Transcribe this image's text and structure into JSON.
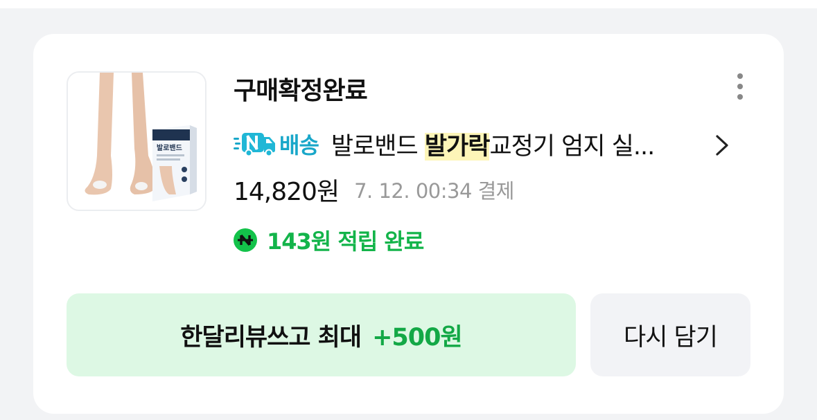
{
  "order": {
    "status": "구매확정완료",
    "delivery_badge": "배송",
    "product_name_prefix": "발로밴드 ",
    "product_name_highlight": "발가락",
    "product_name_suffix": "교정기 엄지 실...",
    "price": "14,820원",
    "paid_at": "7. 12. 00:34 결제",
    "point_reward": "143원 적립 완료",
    "thumbnail_box_text": "발로밴드"
  },
  "actions": {
    "review_label": "한달리뷰쓰고 최대",
    "review_bonus": "+500원",
    "recart_label": "다시 담기"
  },
  "icons": {
    "more": "more-vertical-icon",
    "delivery": "naver-delivery-truck-icon",
    "chevron": "chevron-right-icon",
    "point": "naver-pay-icon"
  },
  "colors": {
    "accent_green": "#13b44a",
    "delivery_blue": "#19a7c9",
    "highlight": "#fdf5b8",
    "review_bg": "#ddf8e4"
  }
}
